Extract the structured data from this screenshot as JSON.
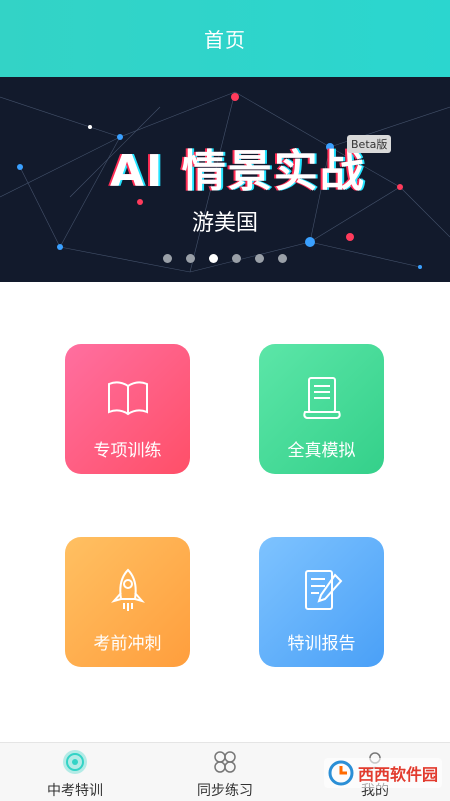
{
  "header": {
    "title": "首页"
  },
  "banner": {
    "title": "AI 情景实战",
    "badge": "Beta版",
    "subtitle": "游美国",
    "dots": [
      false,
      false,
      true,
      false,
      false,
      false
    ]
  },
  "cards": [
    {
      "label": "专项训练",
      "icon": "book-icon"
    },
    {
      "label": "全真模拟",
      "icon": "scroll-icon"
    },
    {
      "label": "考前冲刺",
      "icon": "rocket-icon"
    },
    {
      "label": "特训报告",
      "icon": "report-edit-icon"
    }
  ],
  "tabs": [
    {
      "label": "中考特训",
      "icon": "target-icon",
      "active": true
    },
    {
      "label": "同步练习",
      "icon": "clover-icon",
      "active": false
    },
    {
      "label": "我的",
      "icon": "user-icon",
      "active": false
    }
  ],
  "watermark": "西西软件园"
}
